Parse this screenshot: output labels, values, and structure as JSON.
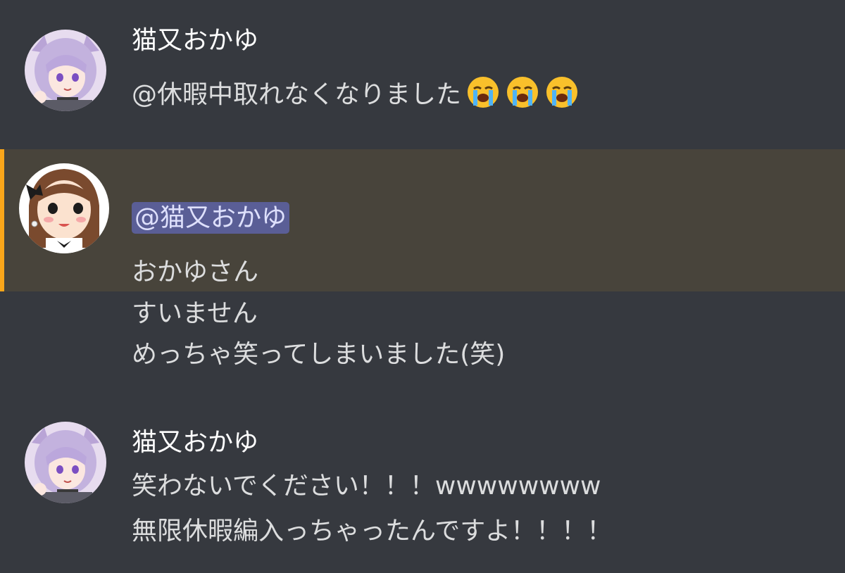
{
  "messages": [
    {
      "author": "猫又おかゆ",
      "avatar": "okayu-avatar",
      "lines": [
        "@休暇中取れなくなりました"
      ],
      "emoji": [
        "loudly-crying-face",
        "loudly-crying-face",
        "loudly-crying-face"
      ]
    },
    {
      "author": "",
      "avatar": "girl-avatar",
      "mention": "@猫又おかゆ",
      "highlighted": true,
      "lines": [
        "おかゆさん",
        "すいません",
        "めっちゃ笑ってしまいました(笑)"
      ]
    },
    {
      "author": "猫又おかゆ",
      "avatar": "okayu-avatar",
      "lines": [
        "笑わないでください！！！wwwwwwww",
        "無限休暇編入っちゃったんですよ！！！！"
      ]
    }
  ],
  "colors": {
    "background": "#36393f",
    "highlight_background": "#48443b",
    "highlight_bar": "#faa61a",
    "mention_background": "#5a5e96",
    "mention_text": "#dee0fc",
    "author_text": "#ffffff",
    "message_text": "#dcddde"
  }
}
